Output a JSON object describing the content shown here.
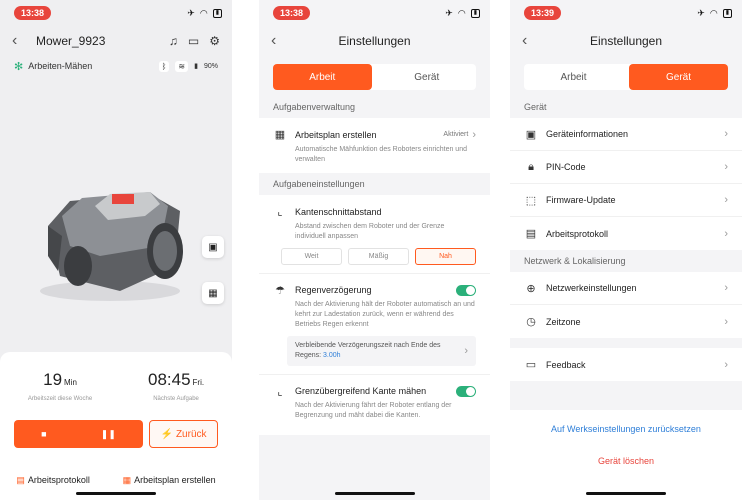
{
  "screen1": {
    "time": "13:38",
    "title": "Mower_9923",
    "status": "Arbeiten-Mähen",
    "battery": "90%",
    "work_time_value": "19",
    "work_time_unit": "Min",
    "work_time_label": "Arbeitszeit diese Woche",
    "next_task_value": "08:45",
    "next_task_unit": "Fri.",
    "next_task_label": "Nächste Aufgabe",
    "back_button": "Zurück",
    "link_protocol": "Arbeitsprotokoll",
    "link_schedule": "Arbeitsplan erstellen"
  },
  "screen2": {
    "time": "13:38",
    "title": "Einstellungen",
    "tabs": [
      "Arbeit",
      "Gerät"
    ],
    "section_tasks": "Aufgabenverwaltung",
    "schedule_label": "Arbeitsplan erstellen",
    "schedule_value": "Aktiviert",
    "schedule_desc": "Automatische Mähfunktion des Roboters einrichten und verwalten",
    "section_task_settings": "Aufgabeneinstellungen",
    "edge_label": "Kantenschnittabstand",
    "edge_desc": "Abstand zwischen dem Roboter und der Grenze individuell anpassen",
    "edge_options": [
      "Weit",
      "Mäßig",
      "Nah"
    ],
    "rain_label": "Regenverzögerung",
    "rain_desc": "Nach der Aktivierung hält der Roboter automatisch an und kehrt zur Ladestation zurück, wenn er während des Betriebs Regen erkennt",
    "rain_remaining_prefix": "Verbleibende Verzögerungszeit nach Ende des Regens:",
    "rain_remaining_value": "3.00h",
    "cross_label": "Grenzübergreifend Kante mähen",
    "cross_desc": "Nach der Aktivierung fährt der Roboter entlang der Begrenzung und mäht dabei die Kanten."
  },
  "screen3": {
    "time": "13:39",
    "title": "Einstellungen",
    "tabs": [
      "Arbeit",
      "Gerät"
    ],
    "section_device": "Gerät",
    "device_items": [
      "Geräteinformationen",
      "PIN-Code",
      "Firmware-Update",
      "Arbeitsprotokoll"
    ],
    "section_network": "Netzwerk & Lokalisierung",
    "network_items": [
      "Netzwerkeinstellungen",
      "Zeitzone"
    ],
    "feedback": "Feedback",
    "reset": "Auf Werkseinstellungen zurücksetzen",
    "delete": "Gerät löschen"
  },
  "colors": {
    "accent": "#ff5a1f",
    "toggle": "#2bb07a",
    "link_blue": "#2f7fd8",
    "danger": "#e8453c"
  }
}
